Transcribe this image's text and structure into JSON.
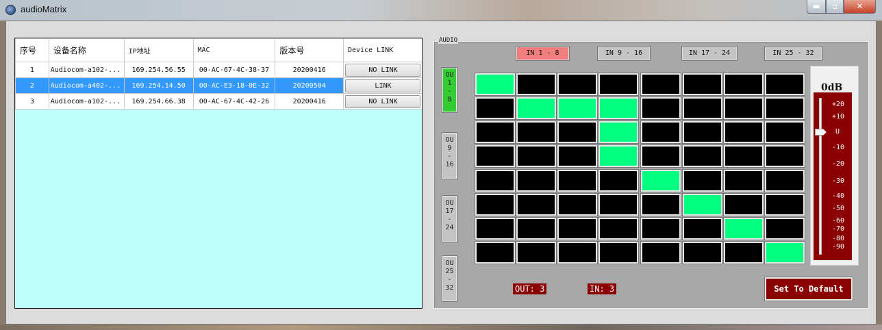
{
  "window": {
    "title": "audioMatrix"
  },
  "table": {
    "headers": [
      "序号",
      "设备名称",
      "IP地址",
      "MAC",
      "版本号",
      "Device LINK"
    ],
    "rows": [
      {
        "index": "1",
        "name": "Audiocom-a102-...",
        "ip": "169.254.56.55",
        "mac": "00-AC-67-4C-38-37",
        "version": "20200416",
        "link": "NO LINK",
        "selected": false
      },
      {
        "index": "2",
        "name": "Audiocom-a402-...",
        "ip": "169.254.14.50",
        "mac": "00-AC-E3-18-0E-32",
        "version": "20200504",
        "link": "LINK",
        "selected": true
      },
      {
        "index": "3",
        "name": "Audiocom-a102-...",
        "ip": "169.254.66.38",
        "mac": "00-AC-67-4C-42-26",
        "version": "20200416",
        "link": "NO LINK",
        "selected": false
      }
    ]
  },
  "audio": {
    "group_label": "AUDIO",
    "in_tabs": [
      "IN 1 - 8",
      "IN 9 - 16",
      "IN 17 - 24",
      "IN 25 - 32"
    ],
    "active_in_tab": 0,
    "out_tabs": [
      [
        "OU",
        "1",
        "-",
        "8"
      ],
      [
        "OU",
        "9",
        "-",
        "16"
      ],
      [
        "OU",
        "17",
        "-",
        "24"
      ],
      [
        "OU",
        "25",
        "-",
        "32"
      ]
    ],
    "active_out_tab": 0,
    "matrix": [
      [
        1,
        0,
        0,
        0,
        0,
        0,
        0,
        0
      ],
      [
        0,
        1,
        1,
        1,
        0,
        0,
        0,
        0
      ],
      [
        0,
        0,
        0,
        1,
        0,
        0,
        0,
        0
      ],
      [
        0,
        0,
        0,
        1,
        0,
        0,
        0,
        0
      ],
      [
        0,
        0,
        0,
        0,
        1,
        0,
        0,
        0
      ],
      [
        0,
        0,
        0,
        0,
        0,
        1,
        0,
        0
      ],
      [
        0,
        0,
        0,
        0,
        0,
        0,
        1,
        0
      ],
      [
        0,
        0,
        0,
        0,
        0,
        0,
        0,
        1
      ]
    ],
    "colors": {
      "on": "#00ff80",
      "off": "#000000",
      "active_in": "#f07e7e",
      "active_out": "#33cc33",
      "accent": "#8b0000"
    },
    "gain_label": "0dB",
    "gain_db": 0,
    "scale_labels": [
      "+20",
      "+10",
      "U",
      "-10",
      "-20",
      "-30",
      "-40",
      "-50",
      "-60",
      "-70",
      "-80",
      "-90"
    ],
    "out_readout": "OUT: 3",
    "in_readout": "IN: 3",
    "default_button": "Set To Default"
  }
}
